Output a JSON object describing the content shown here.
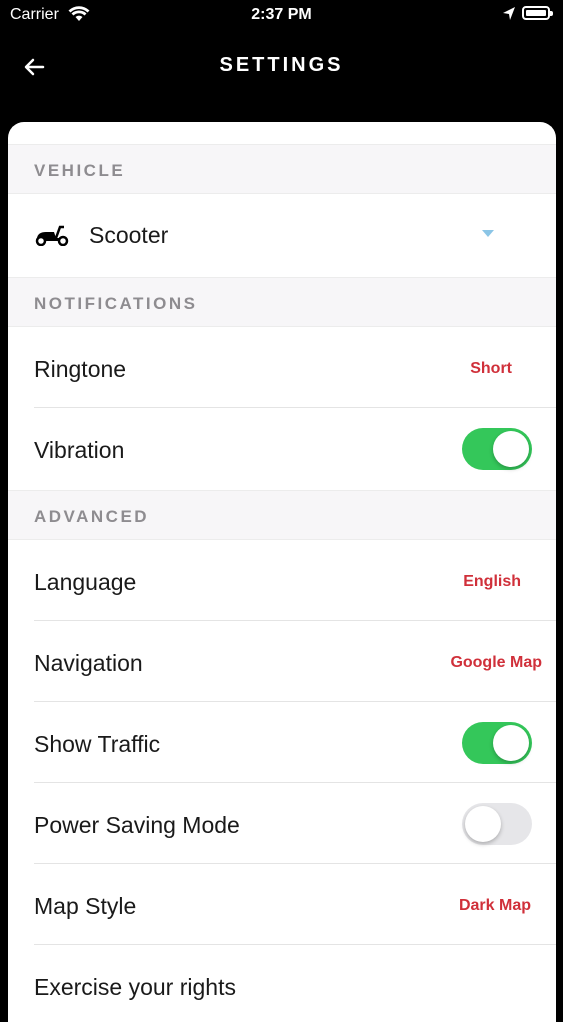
{
  "status_bar": {
    "carrier": "Carrier",
    "time": "2:37 PM"
  },
  "header": {
    "title": "SETTINGS",
    "back_icon": "arrow-left-icon"
  },
  "sections": {
    "vehicle": {
      "title": "VEHICLE",
      "selected": "Scooter",
      "icon": "scooter-icon"
    },
    "notifications": {
      "title": "NOTIFICATIONS",
      "ringtone": {
        "label": "Ringtone",
        "value": "Short"
      },
      "vibration": {
        "label": "Vibration",
        "enabled": true
      }
    },
    "advanced": {
      "title": "ADVANCED",
      "language": {
        "label": "Language",
        "value": "English"
      },
      "navigation": {
        "label": "Navigation",
        "value": "Google Map"
      },
      "show_traffic": {
        "label": "Show Traffic",
        "enabled": true
      },
      "power_saving": {
        "label": "Power Saving Mode",
        "enabled": false
      },
      "map_style": {
        "label": "Map Style",
        "value": "Dark Map"
      },
      "exercise_rights": {
        "label": "Exercise your rights"
      }
    }
  },
  "colors": {
    "accent_red": "#d0303a",
    "toggle_on": "#34c75a",
    "toggle_off": "#e6e6e9",
    "dropdown_chevron": "#8bc5e6"
  }
}
